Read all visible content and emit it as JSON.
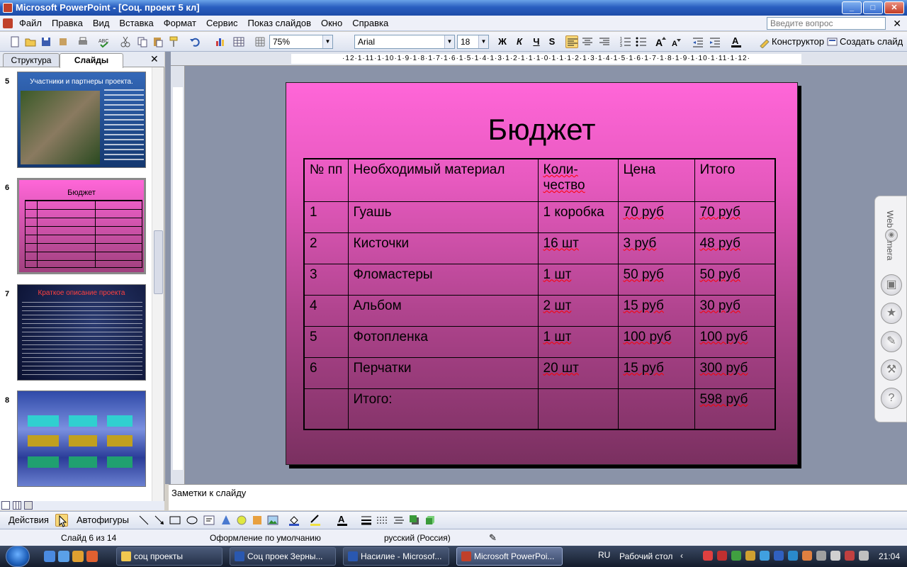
{
  "window": {
    "title": "Microsoft PowerPoint - [Соц. проект 5 кл]",
    "min": "_",
    "max": "□",
    "close": "✕"
  },
  "menu": {
    "items": [
      "Файл",
      "Правка",
      "Вид",
      "Вставка",
      "Формат",
      "Сервис",
      "Показ слайдов",
      "Окно",
      "Справка"
    ],
    "help_placeholder": "Введите вопрос",
    "close": "✕"
  },
  "toolbar": {
    "zoom": "75%",
    "font": "Arial",
    "size": "18",
    "bold": "Ж",
    "italic": "К",
    "underline": "Ч",
    "shadow": "S",
    "designer": "Конструктор",
    "new_slide": "Создать слайд"
  },
  "left_pane": {
    "tab_outline": "Структура",
    "tab_slides": "Слайды",
    "close": "✕",
    "thumbs": [
      {
        "num": "5",
        "title": "Участники и партнеры проекта."
      },
      {
        "num": "6",
        "title": "Бюджет"
      },
      {
        "num": "7",
        "title": "Краткое описание проекта"
      },
      {
        "num": "8",
        "title": ""
      }
    ]
  },
  "ruler": {
    "h": "·12·1·11·1·10·1·9·1·8·1·7·1·6·1·5·1·4·1·3·1·2·1·1·1·0·1·1·1·2·1·3·1·4·1·5·1·6·1·7·1·8·1·9·1·10·1·11·1·12·"
  },
  "slide": {
    "title": "Бюджет",
    "table": {
      "headers": [
        "№ пп",
        "Необходимый материал",
        "Коли-чество",
        "Цена",
        "Итого"
      ],
      "rows": [
        [
          "1",
          "Гуашь",
          "1 коробка",
          "70 руб",
          "70 руб"
        ],
        [
          "2",
          "Кисточки",
          "16 шт",
          "3 руб",
          "48 руб"
        ],
        [
          "3",
          "Фломастеры",
          "1 шт",
          "50 руб",
          "50 руб"
        ],
        [
          "4",
          "Альбом",
          "2 шт",
          "15 руб",
          "30 руб"
        ],
        [
          "5",
          "Фотопленка",
          "1 шт",
          "100 руб",
          "100 руб"
        ],
        [
          "6",
          "Перчатки",
          "20 шт",
          "15 руб",
          "300 руб"
        ]
      ],
      "total": {
        "label": "Итого:",
        "value": "598 руб"
      }
    }
  },
  "webcam": {
    "label": "Web Camera"
  },
  "notes": {
    "placeholder": "Заметки к слайду"
  },
  "drawbar": {
    "actions": "Действия",
    "autoshapes": "Автофигуры"
  },
  "status": {
    "slide": "Слайд 6 из 14",
    "design": "Оформление по умолчанию",
    "lang": "русский (Россия)"
  },
  "taskbar": {
    "tasks": [
      "соц проекты",
      "Соц проек Зерны...",
      "Насилие - Microsof...",
      "Microsoft PowerPoi..."
    ],
    "lang": "RU",
    "desktop": "Рабочий стол",
    "time": "21:04"
  }
}
